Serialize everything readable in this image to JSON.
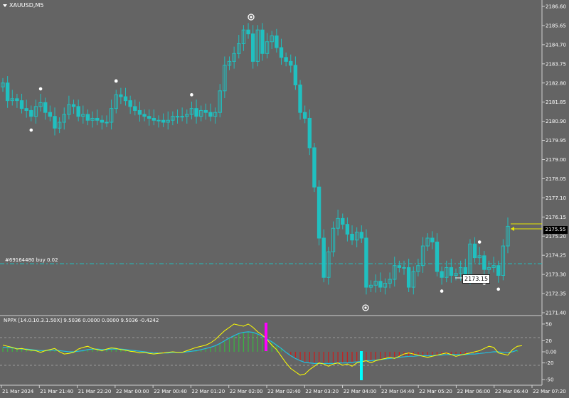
{
  "symbol": "XAUUSD,M5",
  "order_label": "#69164480 buy 0.02",
  "last_price": "2175.55",
  "price_tag": "2173.15",
  "indicator_label": "NPPX [14.0.10.3.1.50X] 9.5036 0.0000 0.0000 9.5036 -0.4242",
  "price_axis": [
    "2186.60",
    "2185.65",
    "2184.70",
    "2183.75",
    "2182.80",
    "2181.85",
    "2180.90",
    "2179.95",
    "2179.00",
    "2178.05",
    "2177.10",
    "2176.15",
    "2175.20",
    "2174.25",
    "2173.30",
    "2172.35",
    "2171.40"
  ],
  "indicator_axis": [
    "50",
    "20",
    "0.00",
    "-20",
    "-50"
  ],
  "time_axis": [
    "21 Mar 2024",
    "21 Mar 21:40",
    "21 Mar 22:20",
    "22 Mar 00:00",
    "22 Mar 00:40",
    "22 Mar 01:20",
    "22 Mar 02:00",
    "22 Mar 02:40",
    "22 Mar 03:20",
    "22 Mar 04:00",
    "22 Mar 04:40",
    "22 Mar 05:20",
    "22 Mar 06:00",
    "22 Mar 06:40",
    "22 Mar 07:20"
  ],
  "colors": {
    "candle": "#20c0c0",
    "background": "#646464",
    "signal_line": "#ffff00",
    "trend_line": "#20c0e0",
    "up_hist": "#3cb043",
    "down_hist": "#c81e1e",
    "peak_marker": "#ff00ff",
    "trough_marker": "#00ffff",
    "order_line": "#20c0c0"
  },
  "chart_data": {
    "type": "candlestick",
    "ylim": [
      2171.2,
      2186.8
    ],
    "close": [
      2182.9,
      2182.0,
      2182.1,
      2182.0,
      2181.6,
      2181.5,
      2181.2,
      2181.7,
      2181.9,
      2181.4,
      2181.2,
      2180.6,
      2180.9,
      2181.3,
      2181.8,
      2181.7,
      2181.2,
      2181.3,
      2181.0,
      2181.1,
      2181.0,
      2180.9,
      2180.9,
      2181.6,
      2182.3,
      2182.2,
      2182.0,
      2181.7,
      2181.5,
      2181.3,
      2181.2,
      2181.1,
      2181.0,
      2181.0,
      2180.9,
      2181.0,
      2181.2,
      2181.2,
      2181.2,
      2181.3,
      2181.6,
      2181.2,
      2181.5,
      2181.4,
      2181.2,
      2181.4,
      2182.5,
      2183.8,
      2184.0,
      2184.4,
      2184.9,
      2185.6,
      2185.4,
      2184.0,
      2185.6,
      2184.4,
      2185.0,
      2185.3,
      2184.7,
      2184.2,
      2184.0,
      2183.8,
      2182.8,
      2181.4,
      2181.1,
      2179.6,
      2177.6,
      2175.0,
      2173.0,
      2174.3,
      2175.5,
      2176.0,
      2175.7,
      2175.2,
      2174.9,
      2175.3,
      2175.0,
      2172.5,
      2172.6,
      2172.8,
      2172.5,
      2172.7,
      2172.9,
      2173.6,
      2173.5,
      2173.5,
      2172.5,
      2173.3,
      2173.6,
      2174.6,
      2175.0,
      2174.8,
      2173.3,
      2173.0,
      2173.5,
      2173.1,
      2173.2,
      2173.5,
      2173.0,
      2174.7,
      2174.0,
      2174.1,
      2173.4,
      2173.5,
      2173.6,
      2173.1,
      2174.6,
      2175.6
    ],
    "indicator_ylim": [
      -55,
      55
    ],
    "signal": [
      12,
      10,
      8,
      5,
      6,
      4,
      3,
      2,
      -1,
      2,
      4,
      6,
      0,
      -4,
      -3,
      -1,
      5,
      8,
      10,
      6,
      4,
      2,
      5,
      7,
      6,
      4,
      3,
      1,
      0,
      -2,
      -1,
      -3,
      -4,
      -3,
      -2,
      -1,
      0,
      -1,
      -1,
      2,
      5,
      8,
      10,
      12,
      16,
      22,
      30,
      38,
      44,
      50,
      48,
      46,
      50,
      44,
      36,
      30,
      22,
      12,
      4,
      -8,
      -20,
      -30,
      -36,
      -42,
      -40,
      -32,
      -26,
      -20,
      -22,
      -26,
      -22,
      -20,
      -24,
      -22,
      -26,
      -20,
      -18,
      -16,
      -20,
      -16,
      -14,
      -12,
      -10,
      -12,
      -8,
      -4,
      -2,
      -4,
      -6,
      -8,
      -10,
      -8,
      -6,
      -4,
      -2,
      -5,
      -8,
      -6,
      -4,
      -2,
      0,
      2,
      6,
      10,
      8,
      -2,
      -4,
      -6,
      4,
      10,
      11
    ],
    "trend": [
      8,
      8,
      7,
      6,
      5,
      5,
      4,
      3,
      2,
      2,
      3,
      3,
      2,
      1,
      0,
      0,
      1,
      2,
      4,
      5,
      5,
      4,
      4,
      5,
      5,
      5,
      4,
      3,
      2,
      1,
      0,
      -1,
      -2,
      -2,
      -2,
      -2,
      -1,
      -1,
      -1,
      0,
      1,
      2,
      4,
      6,
      8,
      11,
      15,
      20,
      25,
      29,
      33,
      35,
      36,
      35,
      32,
      28,
      23,
      18,
      12,
      6,
      -1,
      -7,
      -12,
      -16,
      -19,
      -20,
      -21,
      -21,
      -21,
      -21,
      -21,
      -20,
      -20,
      -20,
      -19,
      -18,
      -17,
      -16,
      -16,
      -15,
      -14,
      -13,
      -12,
      -11,
      -10,
      -9,
      -8,
      -8,
      -7,
      -7,
      -7,
      -7,
      -6,
      -6,
      -5,
      -5,
      -5,
      -5,
      -5,
      -4,
      -4,
      -3,
      -2,
      -1,
      0,
      0,
      -1,
      -1,
      0,
      3
    ]
  }
}
